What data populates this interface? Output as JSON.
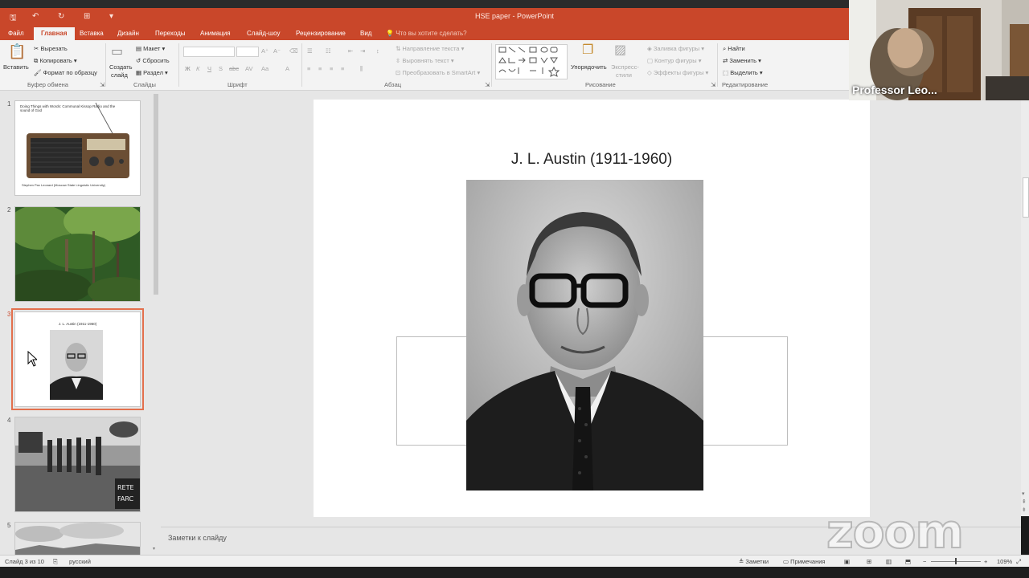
{
  "window": {
    "title": "HSE paper - PowerPoint"
  },
  "tabs": [
    "Файл",
    "Главная",
    "Вставка",
    "Дизайн",
    "Переходы",
    "Анимация",
    "Слайд-шоу",
    "Рецензирование",
    "Вид"
  ],
  "tell_me": "Что вы хотите сделать?",
  "ribbon": {
    "clipboard": {
      "paste": "Вставить",
      "cut": "Вырезать",
      "copy": "Копировать",
      "format": "Формат по образцу",
      "label": "Буфер обмена"
    },
    "slides": {
      "new": "Создать",
      "new2": "слайд",
      "layout": "Макет",
      "reset": "Сбросить",
      "section": "Раздел",
      "label": "Слайды"
    },
    "font": {
      "label": "Шрифт"
    },
    "paragraph": {
      "direction": "Направление текста",
      "align": "Выровнять текст",
      "smartart": "Преобразовать в SmartArt",
      "label": "Абзац"
    },
    "drawing": {
      "arrange": "Упорядочить",
      "express": "Экспресс-",
      "styles": "стили",
      "fill": "Заливка фигуры",
      "outline": "Контур фигуры",
      "effects": "Эффекты фигуры",
      "label": "Рисование"
    },
    "editing": {
      "find": "Найти",
      "replace": "Заменить",
      "select": "Выделить",
      "label": "Редактирование"
    }
  },
  "thumbnails": [
    {
      "num": "1",
      "caption": "Doing Things with Words: Communal Kissop Radio and the sound of God",
      "author": "Stephen Pax Leonard (Moscow State Linguistic University)"
    },
    {
      "num": "2"
    },
    {
      "num": "3",
      "caption": "J. L. Austin (1911-1960)"
    },
    {
      "num": "4",
      "sign1": "RETE",
      "sign2": "FARC"
    },
    {
      "num": "5"
    }
  ],
  "slide": {
    "title": "J. L. Austin (1911-1960)"
  },
  "notes_placeholder": "Заметки к слайду",
  "status": {
    "slide_count": "Слайд 3 из 10",
    "language": "русский",
    "notes": "Заметки",
    "comments": "Примечания",
    "zoom": "109%"
  },
  "video": {
    "name": "Professor Leo..."
  },
  "zoom_logo": "zoom",
  "colors": {
    "accent": "#c9472a",
    "selected_thumb": "#e3704d"
  }
}
